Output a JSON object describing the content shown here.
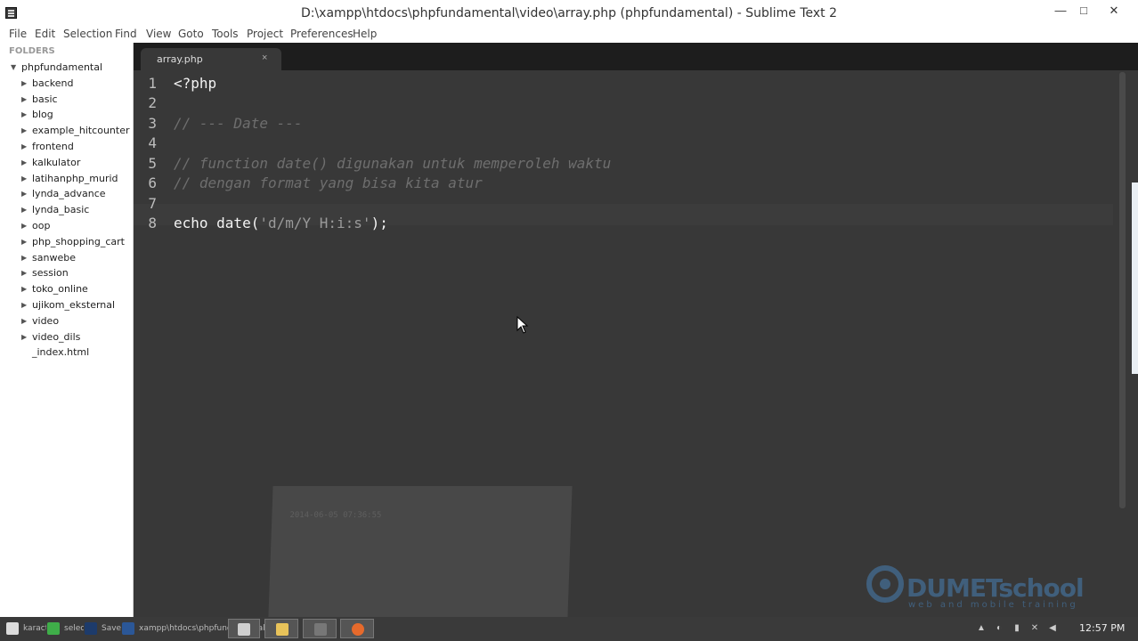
{
  "window": {
    "title": "D:\\xampp\\htdocs\\phpfundamental\\video\\array.php (phpfundamental) - Sublime Text 2",
    "minimize": "—",
    "maximize": "□",
    "close": "✕"
  },
  "menu": [
    "File",
    "Edit",
    "Selection",
    "Find",
    "View",
    "Goto",
    "Tools",
    "Project",
    "Preferences",
    "Help"
  ],
  "sidebar": {
    "header": "FOLDERS",
    "root": "phpfundamental",
    "items": [
      {
        "label": "backend",
        "type": "folder"
      },
      {
        "label": "basic",
        "type": "folder"
      },
      {
        "label": "blog",
        "type": "folder"
      },
      {
        "label": "example_hitcounter",
        "type": "folder"
      },
      {
        "label": "frontend",
        "type": "folder"
      },
      {
        "label": "kalkulator",
        "type": "folder"
      },
      {
        "label": "latihanphp_murid",
        "type": "folder"
      },
      {
        "label": "lynda_advance",
        "type": "folder"
      },
      {
        "label": "lynda_basic",
        "type": "folder"
      },
      {
        "label": "oop",
        "type": "folder"
      },
      {
        "label": "php_shopping_cart",
        "type": "folder"
      },
      {
        "label": "sanwebe",
        "type": "folder"
      },
      {
        "label": "session",
        "type": "folder"
      },
      {
        "label": "toko_online",
        "type": "folder"
      },
      {
        "label": "ujikom_eksternal",
        "type": "folder"
      },
      {
        "label": "video",
        "type": "folder"
      },
      {
        "label": "video_dils",
        "type": "folder"
      },
      {
        "label": "_index.html",
        "type": "file"
      }
    ]
  },
  "tabs": [
    {
      "label": "array.php",
      "close": "×",
      "active": true
    }
  ],
  "editor": {
    "line_numbers": [
      "1",
      "2",
      "3",
      "4",
      "5",
      "6",
      "7",
      "8"
    ],
    "lines": [
      {
        "text": "<?php",
        "kind": "plain"
      },
      {
        "text": "",
        "kind": "plain"
      },
      {
        "text": "// --- Date ---",
        "kind": "comment"
      },
      {
        "text": "",
        "kind": "plain"
      },
      {
        "text": "// function date() digunakan untuk memperoleh waktu",
        "kind": "comment"
      },
      {
        "text": "// dengan format yang bisa kita atur",
        "kind": "comment"
      },
      {
        "text": "",
        "kind": "plain"
      },
      {
        "text": "echo date(",
        "kind": "plain",
        "string": "'d/m/Y H:i:s'",
        "tail": ");"
      }
    ]
  },
  "overlay": {
    "ghost_text": "2014-06-05 07:36:55",
    "watermark_main": "DUMETschool",
    "watermark_sub": "web and mobile training"
  },
  "taskbar": {
    "buttons": [
      "karact",
      "select",
      "Save",
      "xampp\\htdocs\\phpfundamental\\declar.php",
      "",
      "",
      "",
      ""
    ],
    "clock": "12:57 PM"
  },
  "colors": {
    "editor_bg": "#383838",
    "tabbar_bg": "#1d1d1d",
    "sidebar_bg": "#ffffff",
    "comment": "#6e6e6e",
    "watermark": "#4a8fd0"
  }
}
